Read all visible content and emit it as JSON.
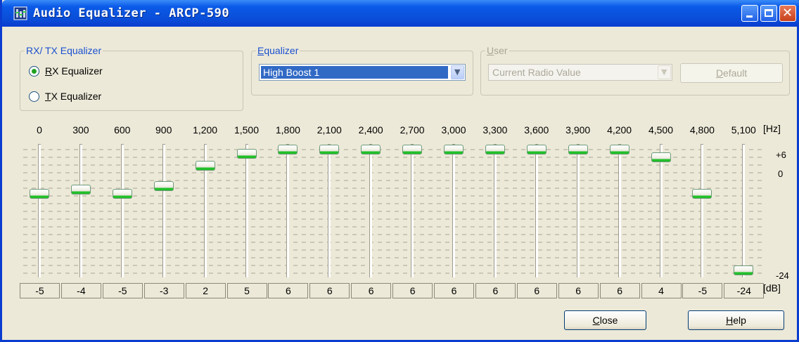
{
  "window": {
    "title": "Audio Equalizer - ARCP-590"
  },
  "rxtx_group": {
    "label": "RX/ TX Equalizer",
    "rx_label_key": "R",
    "rx_label_rest": "X Equalizer",
    "tx_label_key": "T",
    "tx_label_rest": "X Equalizer",
    "selected": "RX Equalizer"
  },
  "equalizer_group": {
    "label_key": "E",
    "label_rest": "qualizer",
    "selected_value": "High Boost 1"
  },
  "user_group": {
    "label_key": "U",
    "label_rest": "ser",
    "selected_value": "Current Radio Value",
    "default_key": "D",
    "default_rest": "efault",
    "enabled": false
  },
  "scale": {
    "hz_unit": "[Hz]",
    "db_unit": "[dB]",
    "plus6_label": "+6",
    "zero_label": "0",
    "minus24_label": "-24",
    "min_db": -24,
    "max_db": 6
  },
  "bands": [
    {
      "freq": "0",
      "value": -5,
      "value_label": "-5"
    },
    {
      "freq": "300",
      "value": -4,
      "value_label": "-4"
    },
    {
      "freq": "600",
      "value": -5,
      "value_label": "-5"
    },
    {
      "freq": "900",
      "value": -3,
      "value_label": "-3"
    },
    {
      "freq": "1,200",
      "value": 2,
      "value_label": "2"
    },
    {
      "freq": "1,500",
      "value": 5,
      "value_label": "5"
    },
    {
      "freq": "1,800",
      "value": 6,
      "value_label": "6"
    },
    {
      "freq": "2,100",
      "value": 6,
      "value_label": "6"
    },
    {
      "freq": "2,400",
      "value": 6,
      "value_label": "6"
    },
    {
      "freq": "2,700",
      "value": 6,
      "value_label": "6"
    },
    {
      "freq": "3,000",
      "value": 6,
      "value_label": "6"
    },
    {
      "freq": "3,300",
      "value": 6,
      "value_label": "6"
    },
    {
      "freq": "3,600",
      "value": 6,
      "value_label": "6"
    },
    {
      "freq": "3,900",
      "value": 6,
      "value_label": "6"
    },
    {
      "freq": "4,200",
      "value": 6,
      "value_label": "6"
    },
    {
      "freq": "4,500",
      "value": 4,
      "value_label": "4"
    },
    {
      "freq": "4,800",
      "value": -5,
      "value_label": "-5"
    },
    {
      "freq": "5,100",
      "value": -24,
      "value_label": "-24"
    }
  ],
  "buttons": {
    "close_key": "C",
    "close_rest": "lose",
    "help_key": "H",
    "help_rest": "elp"
  },
  "icons": {
    "app": "equalizer-app-icon",
    "minimize": "minimize-icon",
    "maximize": "maximize-icon",
    "close": "close-icon",
    "dropdown": "chevron-down-icon"
  },
  "colors": {
    "title_bar": "#0a4ed8",
    "group_label": "#1a50d0",
    "slider_thumb_accent": "#21c029",
    "selection": "#316ac5"
  }
}
